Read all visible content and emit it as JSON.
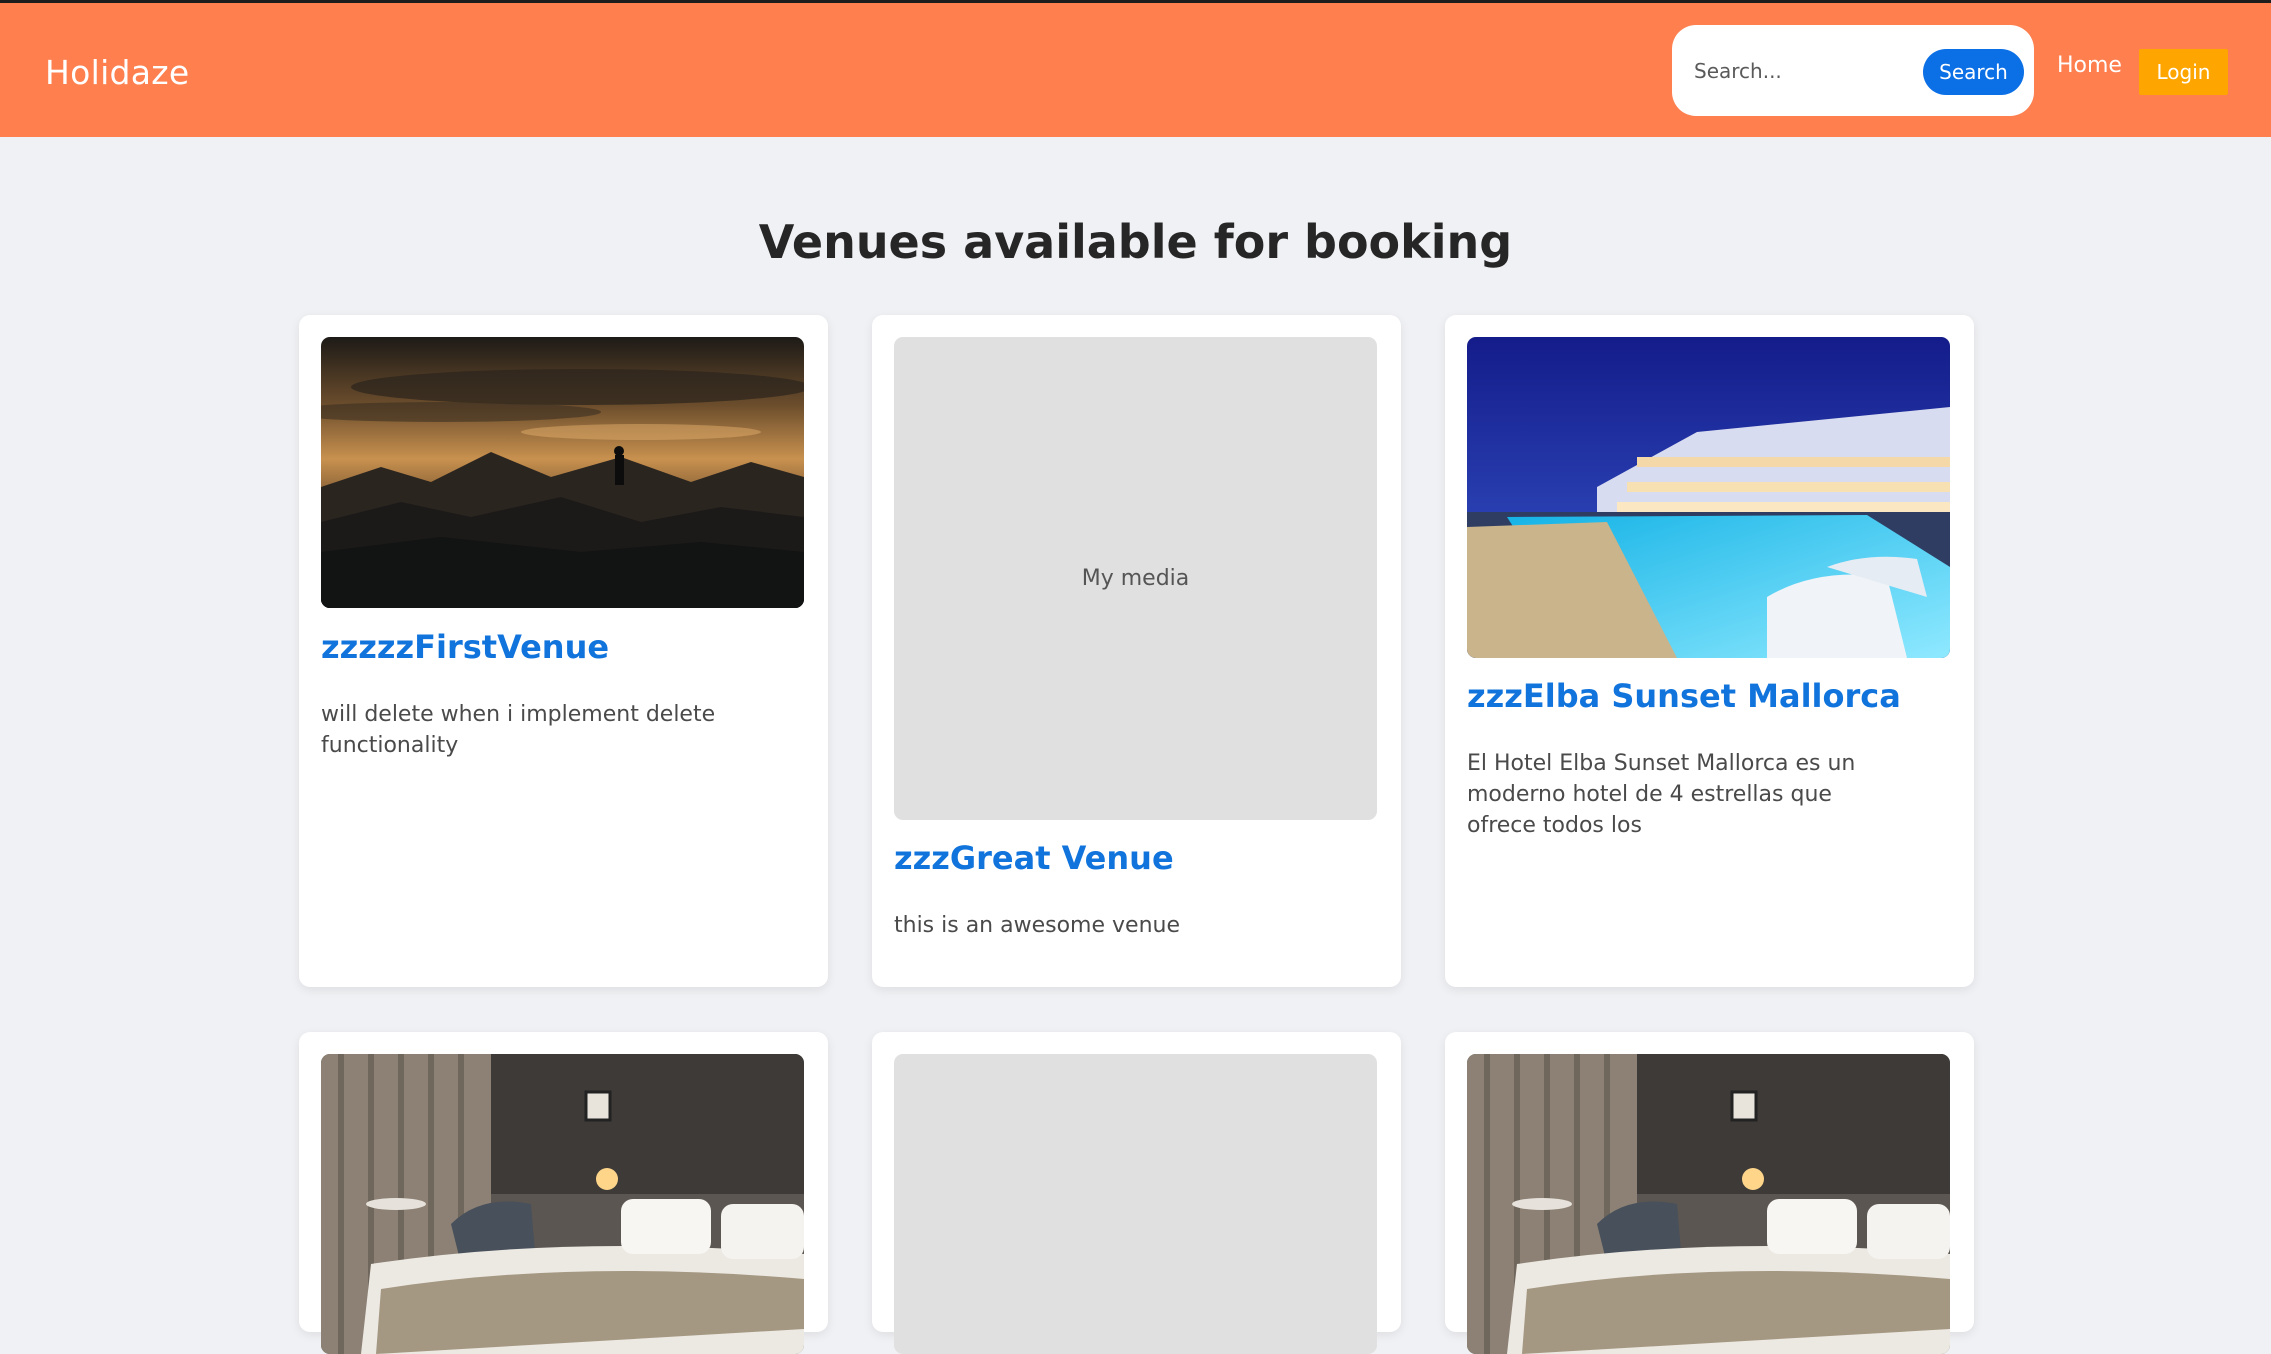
{
  "header": {
    "brand": "Holidaze",
    "search": {
      "placeholder": "Search...",
      "button_label": "Search"
    },
    "nav": {
      "home_label": "Home",
      "login_label": "Login"
    },
    "colors": {
      "bar": "#ff7f4f",
      "search_button": "#0b6fe6",
      "login_button": "#ffa500"
    }
  },
  "main": {
    "title": "Venues available for booking",
    "venues": [
      {
        "name": "zzzzzFirstVenue",
        "description": "will delete when i implement delete functionality",
        "image": "sunset-mountain-photo"
      },
      {
        "name": "zzzGreat Venue",
        "description": "this is an awesome venue",
        "image_placeholder": "My media"
      },
      {
        "name": "zzzElba Sunset Mallorca",
        "description": "El Hotel Elba Sunset Mallorca es un moderno hotel de 4 estrellas que ofrece todos los",
        "image": "hotel-pool-night-photo"
      },
      {
        "image": "hotel-bedroom-photo"
      },
      {
        "image": "placeholder"
      },
      {
        "image": "hotel-bedroom-photo"
      }
    ]
  }
}
